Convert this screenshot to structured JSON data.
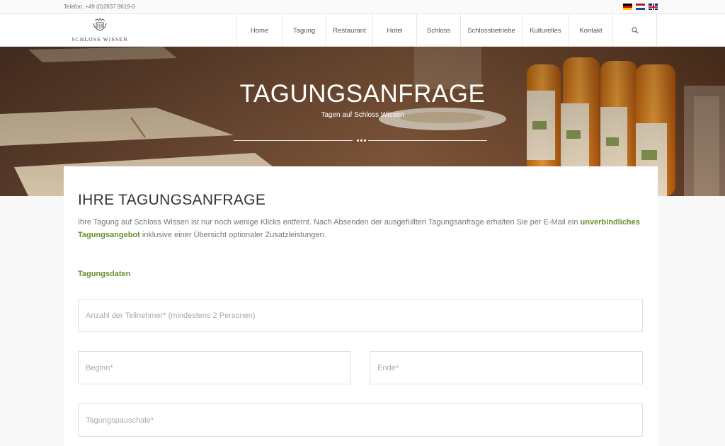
{
  "topbar": {
    "phone": "Telefon: +49 (0)2837 9619-0",
    "languages": [
      {
        "code": "de",
        "icon": "flag-germany-icon"
      },
      {
        "code": "nl",
        "icon": "flag-netherlands-icon"
      },
      {
        "code": "en",
        "icon": "flag-uk-icon"
      }
    ]
  },
  "header": {
    "logo_text": "SCHLOSS WISSEN",
    "nav": [
      "Home",
      "Tagung",
      "Restaurant",
      "Hotel",
      "Schloss",
      "Schlossbetriebe",
      "Kulturelles",
      "Kontakt"
    ],
    "search_icon": "search-icon"
  },
  "hero": {
    "title": "TAGUNGSANFRAGE",
    "subtitle": "Tagen auf Schloss Wissen"
  },
  "content": {
    "title": "IHRE TAGUNGSANFRAGE",
    "intro_part1": "Ihre Tagung auf Schloss Wissen ist nur noch wenige Klicks entfernt. Nach Absenden der ausgefüllten Tagungsanfrage erhalten Sie per E-Mail ein",
    "intro_highlight": "unverbindliches Tagungsangebot",
    "intro_part2": "inklusive einer Übersicht optionaler Zusatzleistungen.",
    "section_label": "Tagungsdaten",
    "fields": {
      "teilnehmer_placeholder": "Anzahl der Teilnehmer* (mindestens 2 Personen)",
      "beginn_placeholder": "Beginn*",
      "ende_placeholder": "Ende*",
      "pauschale_placeholder": "Tagungspauschale*"
    }
  },
  "colors": {
    "accent_green": "#6a8f2c",
    "border": "#e1e1e1"
  }
}
